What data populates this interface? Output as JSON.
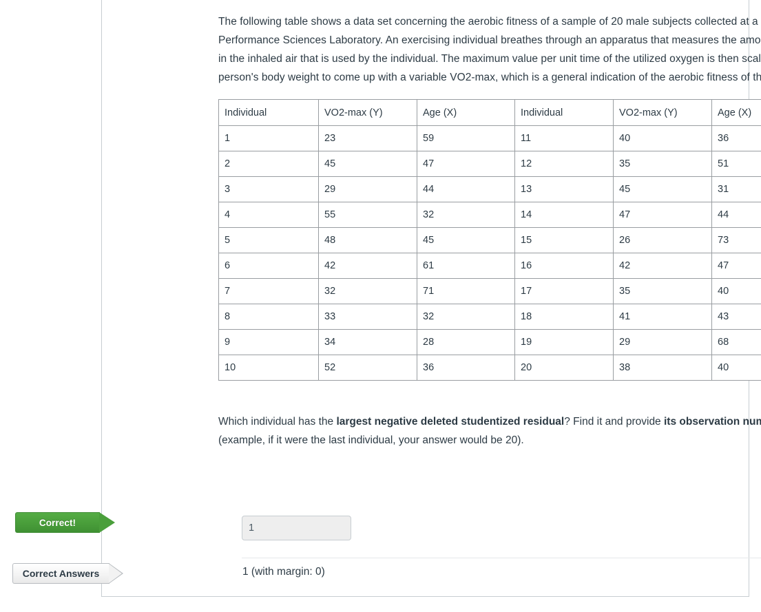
{
  "question": {
    "intro_paragraph": "The following table shows a data set concerning the aerobic fitness of a sample of 20 male subjects collected at a Health an Performance Sciences Laboratory. An exercising individual breathes through an apparatus that measures the amount of oxygen in the inhaled air that is used by the individual. The maximum value per unit time of the utilized oxygen is then scaled by the person's body weight to come up with a variable VO2-max, which is a general indication of the aerobic fitness of the individual.",
    "prompt_part1": "Which individual has the ",
    "prompt_bold1": "largest negative deleted studentized residual",
    "prompt_part2": "? Find it and provide ",
    "prompt_bold2": "its observation number",
    "prompt_part3": " (example, if it were the last individual, your answer would be 20)."
  },
  "table": {
    "headers": [
      "Individual",
      "VO2-max (Y)",
      "Age (X)",
      "Individual",
      "VO2-max (Y)",
      "Age (X)"
    ],
    "rows": [
      [
        "1",
        "23",
        "59",
        "11",
        "40",
        "36"
      ],
      [
        "2",
        "45",
        "47",
        "12",
        "35",
        "51"
      ],
      [
        "3",
        "29",
        "44",
        "13",
        "45",
        "31"
      ],
      [
        "4",
        "55",
        "32",
        "14",
        "47",
        "44"
      ],
      [
        "5",
        "48",
        "45",
        "15",
        "26",
        "73"
      ],
      [
        "6",
        "42",
        "61",
        "16",
        "42",
        "47"
      ],
      [
        "7",
        "32",
        "71",
        "17",
        "35",
        "40"
      ],
      [
        "8",
        "33",
        "32",
        "18",
        "41",
        "43"
      ],
      [
        "9",
        "34",
        "28",
        "19",
        "29",
        "68"
      ],
      [
        "10",
        "52",
        "36",
        "20",
        "38",
        "40"
      ]
    ]
  },
  "answer": {
    "student_answer_value": "1",
    "student_answer_placeholder": "",
    "correct_answer_text": "1 (with margin: 0)"
  },
  "badges": {
    "correct_label": "Correct!",
    "correct_answers_label": "Correct Answers"
  },
  "colors": {
    "correct_green": "#4a9f3b",
    "text": "#2d3b45",
    "border": "#c7cdd1",
    "input_background": "#eeeeee"
  }
}
